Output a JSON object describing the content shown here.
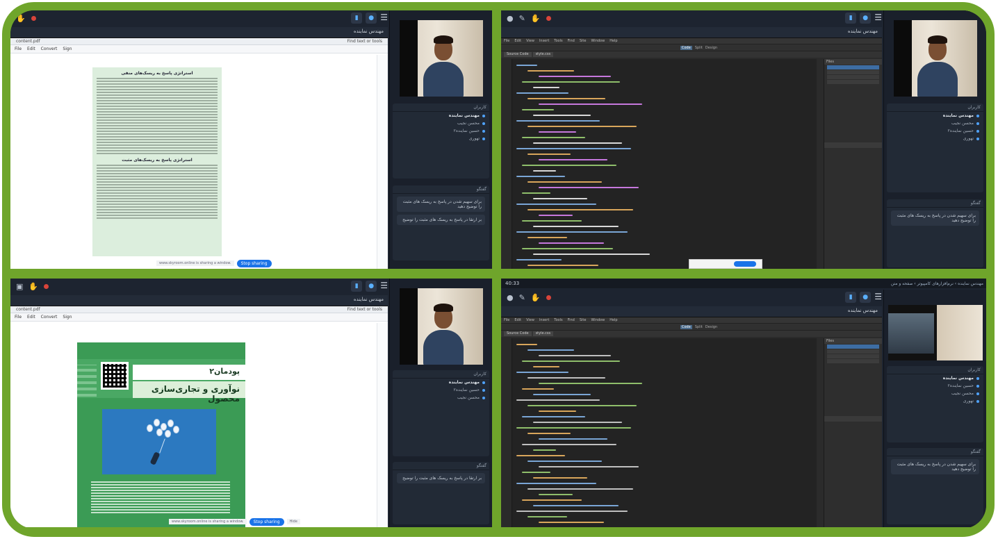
{
  "presenter_name": "مهندس نماینده",
  "users_panel": {
    "label": "کاربران",
    "users": [
      "مهندس نماینده",
      "محسن نجیب",
      "حسین نماینده٢",
      "تهوری"
    ]
  },
  "chat_panel": {
    "label": "گفتگو",
    "messages": [
      "برای سهیم شدن در پاسخ به ریسک های مثبت را توضیح دهید",
      "بر ارتقا در پاسخ به ریسک های مثبت را توضیح"
    ]
  },
  "share_bar": {
    "text": "www.skyroom.online is sharing a window.",
    "stop_label": "Stop sharing",
    "hide_label": "Hide"
  },
  "doc_top": {
    "heading_1": "استراتژی پاسخ به ریسک‌های منفی",
    "heading_2": "استراتژی پاسخ به ریسک‌های مثبت"
  },
  "book": {
    "chapter": "پودمان۲",
    "subtitle": "نوآوری و تجاری‌سازی محصول"
  },
  "doc_window": {
    "tab_label": "content.pdf",
    "menu": [
      "File",
      "Edit",
      "Convert",
      "Sign"
    ],
    "find_label": "Find text or tools"
  },
  "ide": {
    "menu": [
      "File",
      "Edit",
      "View",
      "Insert",
      "Tools",
      "Find",
      "Site",
      "Window",
      "Help"
    ],
    "modes": [
      "Code",
      "Split",
      "Design"
    ],
    "tabs": [
      "Source Code",
      "style.css"
    ],
    "panel_title": "Files",
    "tree_items": [
      "Site",
      "images",
      "css",
      "index.html"
    ]
  },
  "bottom_right": {
    "time": "40:33",
    "breadcrumb": "مهندس نماینده › نرم‌افزارهای کامپیوتر › صفحه و متن"
  },
  "colors": {
    "frame": "#6fa52b",
    "app_bg": "#1d2430",
    "accent": "#4fa3ff",
    "record": "#d9443a"
  }
}
